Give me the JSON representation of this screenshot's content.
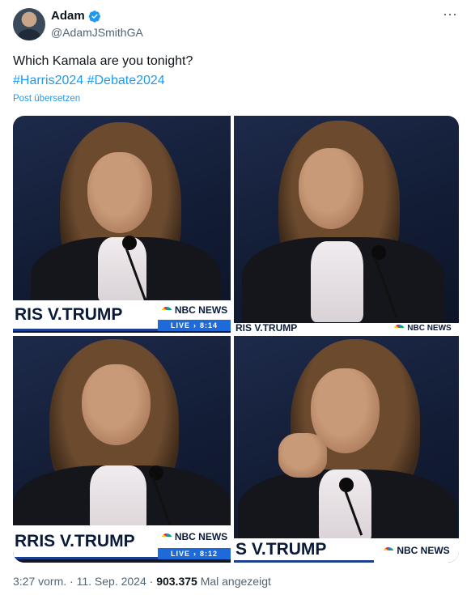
{
  "author": {
    "display_name": "Adam",
    "handle": "@AdamJSmithGA"
  },
  "tweet": {
    "text": "Which Kamala are you tonight?",
    "hashtags": "#Harris2024 #Debate2024",
    "translate_label": "Post übersetzen"
  },
  "images": [
    {
      "title": "RIS V.TRUMP",
      "brand": "NBC NEWS",
      "live": "LIVE",
      "time": "8:14"
    },
    {
      "title": "RIS V.TRUMP",
      "brand": "NBC NEWS",
      "live": "",
      "time": ""
    },
    {
      "title": "RRIS V.TRUMP",
      "brand": "NBC NEWS",
      "live": "LIVE",
      "time": "8:12"
    },
    {
      "title": "S V.TRUMP",
      "brand": "NBC NEWS",
      "live": "",
      "time": ""
    }
  ],
  "footer": {
    "time": "3:27 vorm.",
    "separator1": " · ",
    "date": "11. Sep. 2024",
    "separator2": " · ",
    "views": "903.375",
    "views_label": " Mal angezeigt"
  },
  "colors": {
    "accent": "#1d9bf0",
    "muted": "#536471",
    "nbc_blue": "#1e6ad8"
  }
}
